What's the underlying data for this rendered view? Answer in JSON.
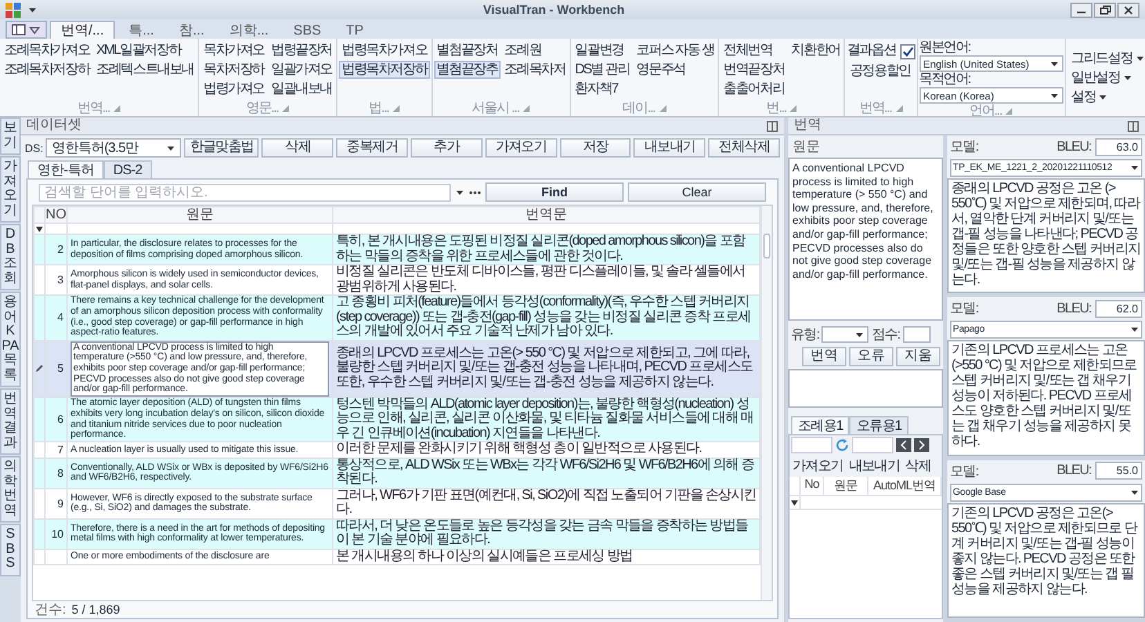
{
  "window": {
    "title": "VisualTran - Workbench"
  },
  "ribbon": {
    "tabs": [
      {
        "label": "번역/...",
        "selected": true
      },
      {
        "label": "특...",
        "selected": false
      },
      {
        "label": "참...",
        "selected": false
      },
      {
        "label": "의학...",
        "selected": false
      },
      {
        "label": "SBS",
        "selected": false
      },
      {
        "label": "TP",
        "selected": false
      }
    ],
    "groups": [
      {
        "label": "번역...",
        "columns": [
          [
            {
              "kind": "button",
              "label": "조례목차가져오",
              "highlighted": false
            },
            {
              "kind": "button",
              "label": "조례목차저장하",
              "highlighted": false
            }
          ],
          [
            {
              "kind": "button",
              "label": "XML일괄저장하",
              "highlighted": false
            },
            {
              "kind": "button",
              "label": "조례텍스트내보내",
              "highlighted": false
            }
          ]
        ]
      },
      {
        "label": "영문...",
        "columns": [
          [
            {
              "kind": "button",
              "label": "목차가져오",
              "highlighted": false
            },
            {
              "kind": "button",
              "label": "목차저장하",
              "highlighted": false
            },
            {
              "kind": "button",
              "label": "법령가져오",
              "highlighted": false
            }
          ],
          [
            {
              "kind": "button",
              "label": "법령끝장처",
              "highlighted": false
            },
            {
              "kind": "button",
              "label": "일괄가져오",
              "highlighted": false
            },
            {
              "kind": "button",
              "label": "일괄내보내",
              "highlighted": false
            }
          ]
        ]
      },
      {
        "label": "법...",
        "columns": [
          [
            {
              "kind": "button",
              "label": "법령목차가져오",
              "highlighted": false
            },
            {
              "kind": "button",
              "label": "법령목차저장하",
              "highlighted": true
            }
          ]
        ]
      },
      {
        "label": "서울시 ...",
        "columns": [
          [
            {
              "kind": "button",
              "label": "별첨끝장처",
              "highlighted": false
            },
            {
              "kind": "button",
              "label": "별첨끝장추",
              "highlighted": true
            }
          ],
          [
            {
              "kind": "button",
              "label": "조례원",
              "highlighted": false
            },
            {
              "kind": "button",
              "label": "조례목차저",
              "highlighted": false
            }
          ]
        ]
      },
      {
        "label": "데이...",
        "columns": [
          [
            {
              "kind": "button",
              "label": "일괄변경",
              "highlighted": false
            },
            {
              "kind": "button",
              "label": "DS별 관리",
              "highlighted": false
            },
            {
              "kind": "button",
              "label": "환자책7",
              "highlighted": false
            }
          ],
          [
            {
              "kind": "button",
              "label": "코퍼스 자동 생",
              "highlighted": false
            },
            {
              "kind": "button",
              "label": "영문주석",
              "highlighted": false
            }
          ]
        ]
      },
      {
        "label": "번...",
        "columns": [
          [
            {
              "kind": "button",
              "label": "전체번역",
              "highlighted": false
            },
            {
              "kind": "button",
              "label": "번역끝장처",
              "highlighted": false
            },
            {
              "kind": "button",
              "label": "출출어처리",
              "highlighted": false
            }
          ],
          [
            {
              "kind": "button",
              "label": "치환한어",
              "highlighted": false
            }
          ]
        ]
      },
      {
        "label": "번역...",
        "columns": [
          [
            {
              "kind": "checkbox",
              "label": "결과옵션",
              "checked": true
            },
            {
              "kind": "button",
              "label": "공정용할인",
              "highlighted": false
            }
          ]
        ]
      },
      {
        "label": "언어...",
        "columns": [
          [
            {
              "kind": "combo",
              "label": "원본언어:",
              "value": "English (United States)"
            },
            {
              "kind": "combo",
              "label": "목적언어:",
              "value": "Korean (Korea)"
            }
          ]
        ]
      }
    ],
    "menus": [
      {
        "label": "그리드설정"
      },
      {
        "label": "일반설정"
      },
      {
        "label": "설정"
      }
    ]
  },
  "side_tabs": [
    {
      "label": "보기"
    },
    {
      "label": "가져오기"
    },
    {
      "label": "DB조회"
    },
    {
      "label": "용어 KPA 목록"
    },
    {
      "label": "번역결과"
    },
    {
      "label": "의학번역"
    },
    {
      "label": "SBS"
    }
  ],
  "dataset_panel": {
    "title": "데이터셋",
    "ds_label": "DS:",
    "ds_value": "영한특허(3.5만",
    "buttons": [
      "한글맞춤법",
      "삭제",
      "중복제거",
      "추가",
      "가져오기",
      "저장",
      "내보내기",
      "전체삭제"
    ],
    "tabs": [
      {
        "label": "영한-특허",
        "selected": true
      },
      {
        "label": "DS-2",
        "selected": false
      }
    ],
    "search": {
      "placeholder": "검색할 단어를 입력하시오."
    },
    "find": "Find",
    "clear": "Clear",
    "columns": [
      "NO",
      "원문",
      "번역문"
    ],
    "rows": [
      {
        "no": "2",
        "source": "In particular, the disclosure relates to processes for the deposition of films comprising doped amorphous silicon.",
        "target": "특히, 본 개시내용은 도핑된 비정질 실리콘(doped amorphous silicon)을 포함하는 막들의 증착을 위한 프로세스들에 관한 것이다.",
        "selected": false,
        "editing": false
      },
      {
        "no": "3",
        "source": "Amorphous silicon is widely used in semiconductor devices, flat-panel displays, and solar cells.",
        "target": "비정질 실리콘은 반도체 디바이스들, 평판 디스플레이들, 및 솔라 셀들에서 광범위하게 사용된다.",
        "selected": false,
        "editing": false
      },
      {
        "no": "4",
        "source": "There remains a key technical challenge for the development of an amorphous silicon deposition process with conformality (i.e., good step coverage) or gap-fill performance in high aspect-ratio features.",
        "target": "고 종횡비 피처(feature)들에서 등각성(conformality)(즉, 우수한 스텝 커버리지(step coverage)) 또는 갭-충전(gap-fill) 성능을 갖는 비정질 실리콘 증착 프로세스의 개발에 있어서 주요 기술적 난제가 남아 있다.",
        "selected": false,
        "editing": false
      },
      {
        "no": "5",
        "source": "A conventional LPCVD process is limited to high temperature (>550 °C) and low pressure, and, therefore, exhibits poor step coverage and/or gap-fill performance; PECVD processes also do not give good step coverage and/or gap-fill performance.",
        "target": "종래의 LPCVD 프로세스는 고온(> 550 °C) 및 저압으로 제한되고, 그에 따라, 불량한 스텝 커버리지 및/또는 갭-충전 성능을 나타내며, PECVD 프로세스도 또한, 우수한 스텝 커버리지 및/또는 갭-충전 성능을 제공하지 않는다.",
        "selected": true,
        "editing": true
      },
      {
        "no": "6",
        "source": "The atomic layer deposition (ALD) of tungsten thin films exhibits very long incubation delay's on silicon, silicon dioxide and titanium nitride services due to poor nucleation performance.",
        "target": "텅스텐 박막들의 ALD(atomic layer deposition)는, 불량한 핵형성(nucleation) 성능으로 인해, 실리콘, 실리콘 이산화물, 및 티타늄 질화물 서비스들에 대해 매우 긴 인큐베이션(incubation) 지연들을 나타낸다.",
        "selected": false,
        "editing": false
      },
      {
        "no": "7",
        "source": "A nucleation layer is usually used to mitigate this issue.",
        "target": "이러한 문제를 완화시키기 위해 핵형성 층이 일반적으로 사용된다.",
        "selected": false,
        "editing": false
      },
      {
        "no": "8",
        "source": "Conventionally, ALD WSix or WBx is deposited by WF6/Si2H6 and WF6/B2H6, respectively.",
        "target": "통상적으로, ALD WSix 또는 WBx는 각각 WF6/Si2H6 및 WF6/B2H6에 의해 증착된다.",
        "selected": false,
        "editing": false
      },
      {
        "no": "9",
        "source": "However, WF6 is directly exposed to the substrate surface (e.g., Si, SiO2) and damages the substrate.",
        "target": "그러나, WF6가 기판 표면(예컨대, Si, SiO2)에 직접 노출되어 기판을 손상시킨다.",
        "selected": false,
        "editing": false
      },
      {
        "no": "10",
        "source": "Therefore, there is a need in the art for methods of depositing metal films with high conformality at lower temperatures.",
        "target": "따라서, 더 낮은 온도들로 높은 등각성을 갖는 금속 막들을 증착하는 방법들이 본 기술 분야에 필요하다.",
        "selected": false,
        "editing": false
      },
      {
        "source": "One or more embodiments of the disclosure are",
        "target": "본 개시내용의 하나 이상의 실시예들은 프로세싱 방법",
        "selected": false,
        "editing": false
      }
    ],
    "count_label": "건수:",
    "count": "5 / 1,869"
  },
  "translation_panel": {
    "title": "번역",
    "source_label": "원문",
    "source_text": "A conventional LPCVD process is limited to high temperature (> 550 °C) and low pressure, and, therefore, exhibits poor step coverage and/or gap-fill performance; PECVD processes also do not give good step coverage and/or gap-fill performance.",
    "type_label": "유형:",
    "score_label": "점수:",
    "actions": [
      "번역",
      "오류",
      "지움"
    ],
    "tabs": [
      {
        "label": "조례용1",
        "selected": true
      },
      {
        "label": "오류용1",
        "selected": false
      }
    ],
    "toolbar": [
      "가져오기",
      "내보내기",
      "삭제"
    ],
    "columns": [
      "No",
      "원문",
      "AutoML번역"
    ]
  },
  "models": [
    {
      "label": "모델:",
      "name": "TP_EK_ME_1221_2_20201221110512",
      "bleu_label": "BLEU:",
      "bleu": "63.0",
      "text": "종래의 LPCVD 공정은 고온 (> 550℃) 및 저압으로 제한되며, 따라서, 열악한 단계 커버리지 및/또는 갭-필 성능을 나타낸다; PECVD 공정들은 또한 양호한 스텝 커버리지 및/또는 갭-필 성능을 제공하지 않는다."
    },
    {
      "label": "모델:",
      "name": "Papago",
      "bleu_label": "BLEU:",
      "bleu": "62.0",
      "text": "기존의 LPCVD 프로세스는 고온(>550 °C) 및 저압으로 제한되므로 스텝 커버리지 및/또는 갭 채우기 성능이 저하된다. PECVD 프로세스도 양호한 스텝 커버리지 및/또는 갭 채우기 성능을 제공하지 못하다."
    },
    {
      "label": "모델:",
      "name": "Google Base",
      "bleu_label": "BLEU:",
      "bleu": "55.0",
      "text": "기존의 LPCVD 공정은 고온(> 550℃) 및 저압으로 제한되므로 단계 커버리지 및/또는 갭-필 성능이 좋지 않는다. PECVD 공정은 또한 좋은 스텝 커버리지 및/또는 갭 필 성능을 제공하지 않는다."
    }
  ]
}
